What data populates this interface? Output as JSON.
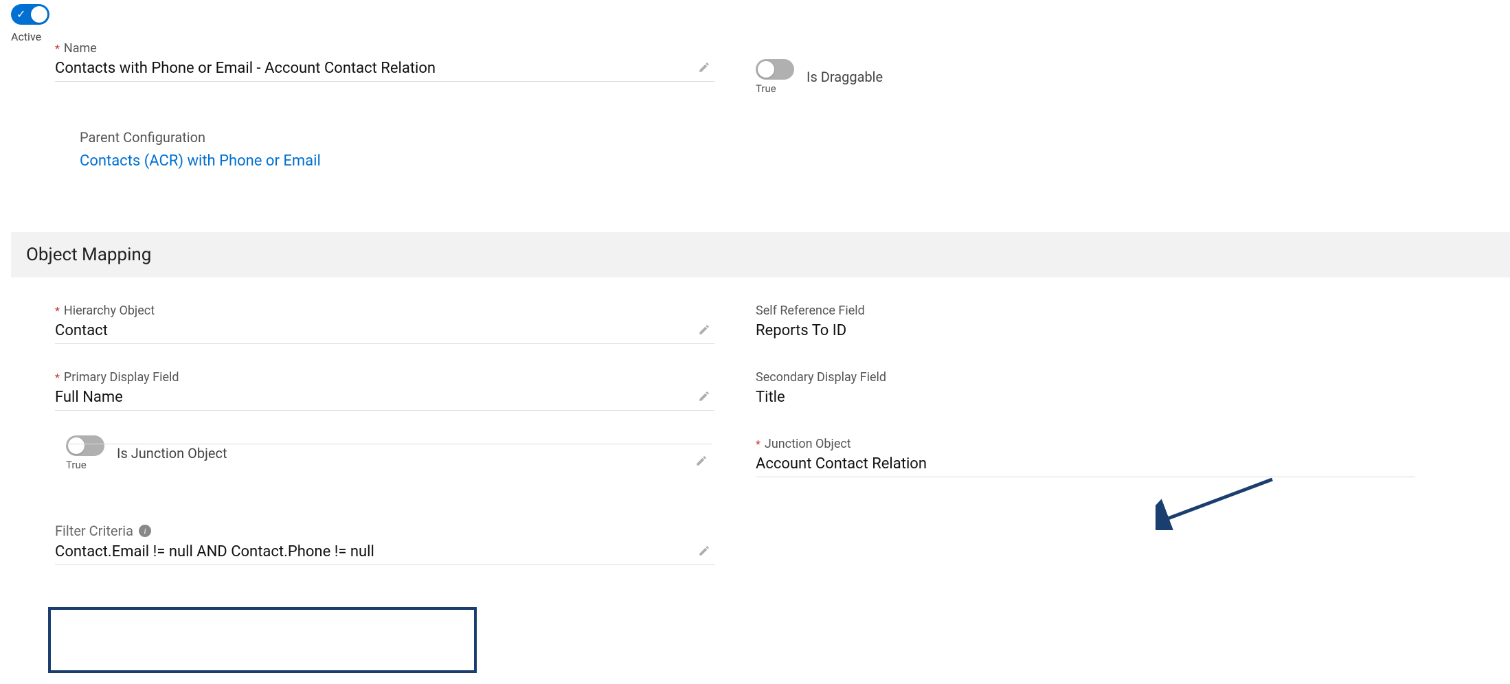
{
  "active_toggle": {
    "label": "Active",
    "on": true
  },
  "name_field": {
    "label": "Name",
    "value": "Contacts with Phone or Email - Account Contact Relation"
  },
  "is_draggable": {
    "label": "Is Draggable",
    "sub": "True",
    "on": true
  },
  "parent_config": {
    "label": "Parent Configuration",
    "link_text": "Contacts (ACR) with Phone or Email"
  },
  "section": {
    "object_mapping": "Object Mapping"
  },
  "hierarchy_object": {
    "label": "Hierarchy Object",
    "value": "Contact"
  },
  "self_reference_field": {
    "label": "Self Reference Field",
    "value": "Reports To ID"
  },
  "primary_display_field": {
    "label": "Primary Display Field",
    "value": "Full Name"
  },
  "secondary_display_field": {
    "label": "Secondary Display Field",
    "value": "Title"
  },
  "is_junction_object": {
    "label": "Is Junction Object",
    "sub": "True",
    "on": true
  },
  "junction_object": {
    "label": "Junction Object",
    "value": "Account Contact Relation"
  },
  "filter_criteria": {
    "label": "Filter Criteria",
    "value": "Contact.Email != null AND Contact.Phone != null"
  },
  "annotations": {
    "filter_highlight": true,
    "arrow_to_junction": true
  }
}
